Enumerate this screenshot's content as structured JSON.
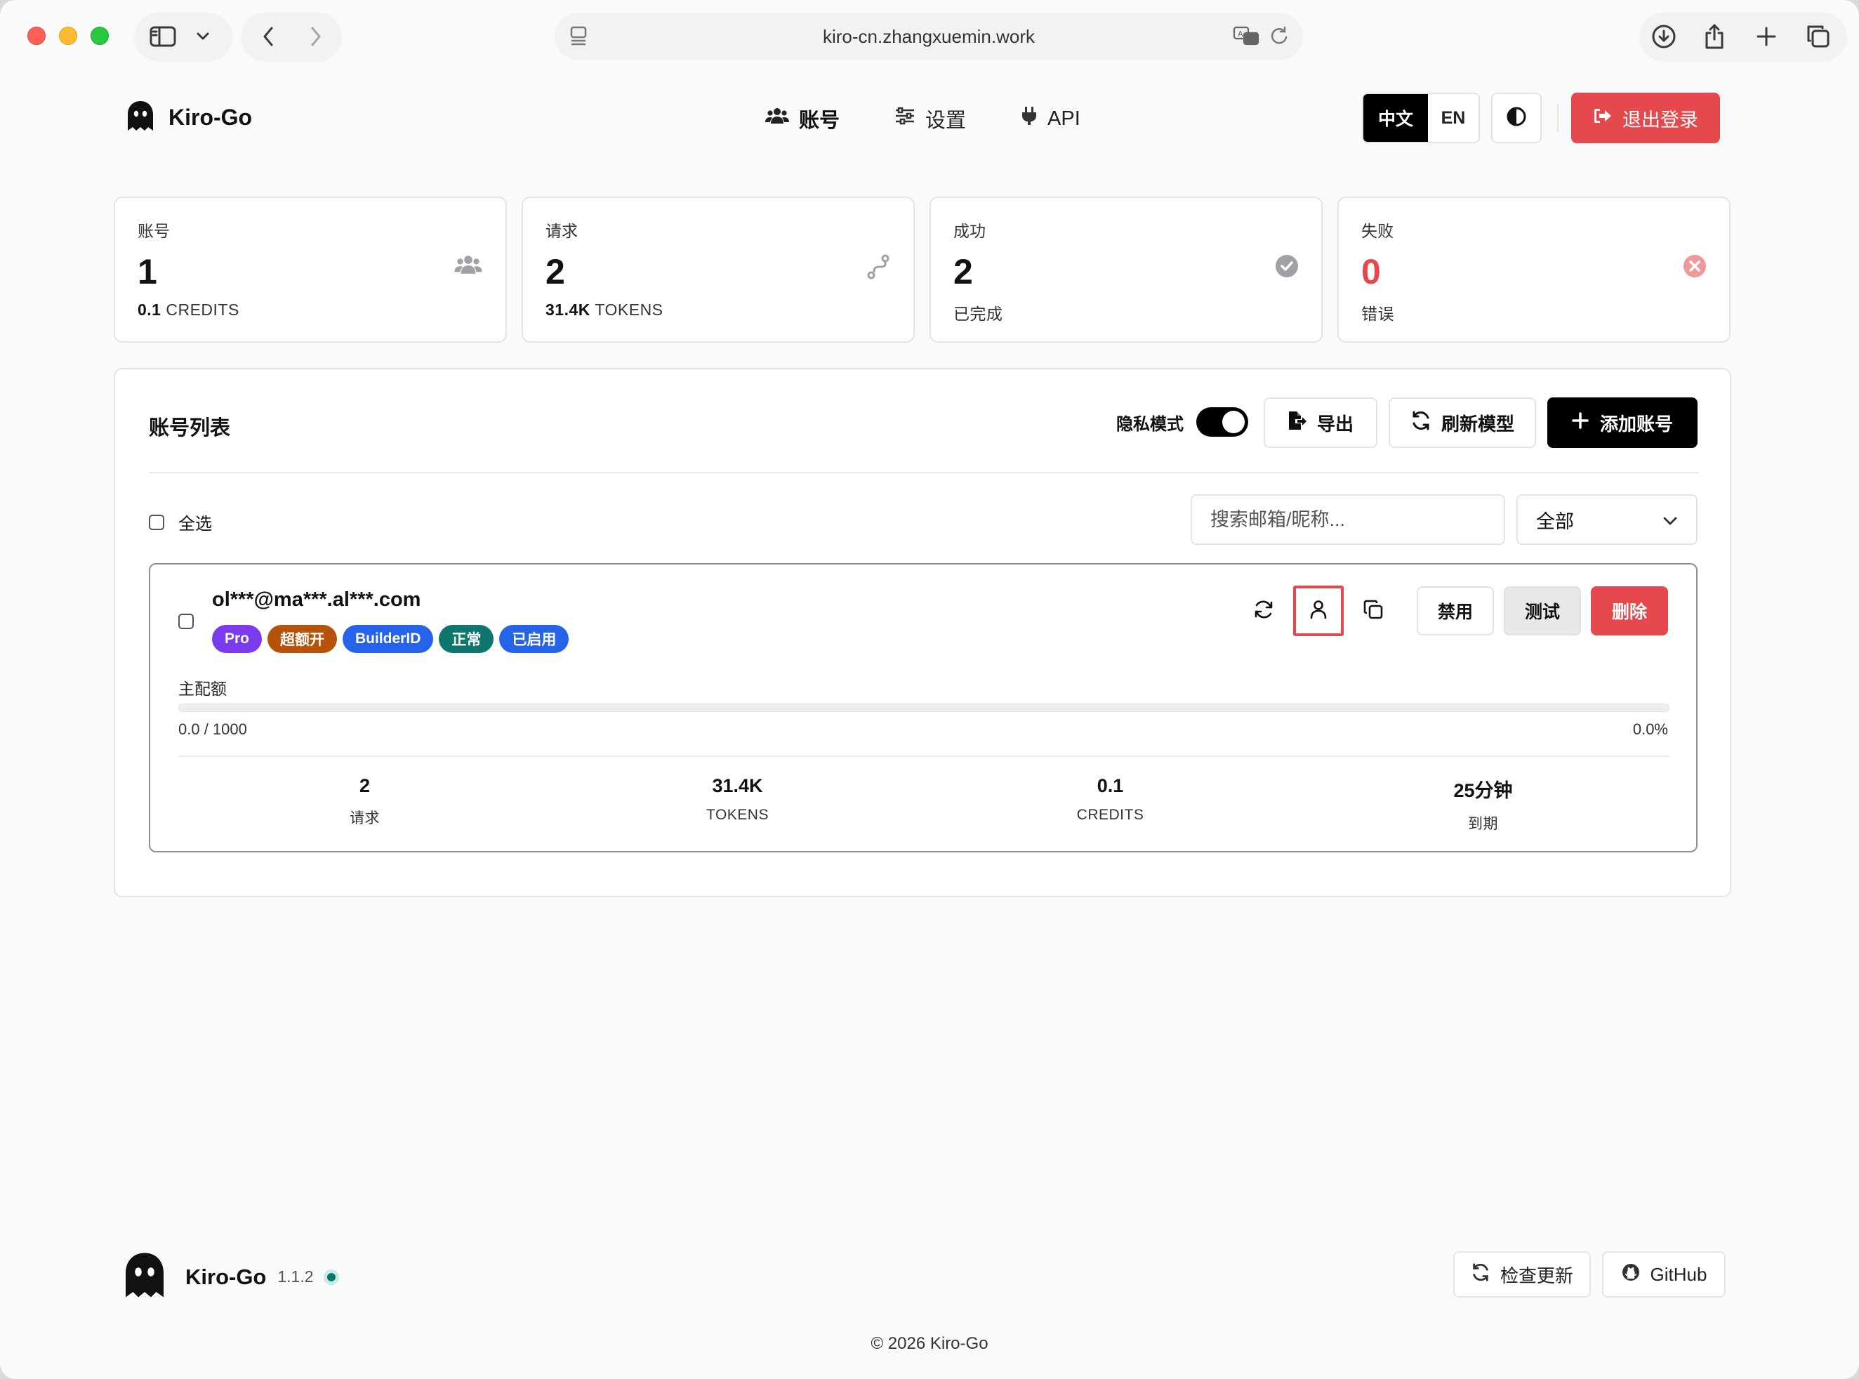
{
  "browser": {
    "url": "kiro-cn.zhangxuemin.work"
  },
  "header": {
    "brand": "Kiro-Go",
    "nav": [
      {
        "label": "账号",
        "icon": "users-icon"
      },
      {
        "label": "设置",
        "icon": "sliders-icon"
      },
      {
        "label": "API",
        "icon": "plug-icon"
      }
    ],
    "lang_zh": "中文",
    "lang_en": "EN",
    "logout": "退出登录"
  },
  "stats": [
    {
      "label": "账号",
      "value": "1",
      "sub_value": "0.1",
      "sub_label": "CREDITS",
      "icon": "users-icon"
    },
    {
      "label": "请求",
      "value": "2",
      "sub_value": "31.4K",
      "sub_label": "TOKENS",
      "icon": "route-icon"
    },
    {
      "label": "成功",
      "value": "2",
      "sub_value": "",
      "sub_label": "已完成",
      "icon": "check-circle-icon"
    },
    {
      "label": "失败",
      "value": "0",
      "sub_value": "",
      "sub_label": "错误",
      "icon": "x-circle-icon"
    }
  ],
  "panel": {
    "title": "账号列表",
    "privacy_label": "隐私模式",
    "export": "导出",
    "refresh_models": "刷新模型",
    "add_account": "添加账号",
    "select_all": "全选",
    "search_placeholder": "搜索邮箱/昵称...",
    "filter_value": "全部"
  },
  "account": {
    "email": "ol***@ma***.al***.com",
    "badges": [
      {
        "label": "Pro",
        "color": "#7c3aed"
      },
      {
        "label": "超额开",
        "color": "#b45309"
      },
      {
        "label": "BuilderID",
        "color": "#2563eb"
      },
      {
        "label": "正常",
        "color": "#0f766e"
      },
      {
        "label": "已启用",
        "color": "#2563eb"
      }
    ],
    "disable": "禁用",
    "test": "测试",
    "delete": "删除",
    "quota_label": "主配额",
    "quota_used": "0.0 / 1000",
    "quota_pct": "0.0%",
    "quota_fraction": 0.0,
    "stats": [
      {
        "value": "2",
        "label": "请求"
      },
      {
        "value": "31.4K",
        "label": "TOKENS"
      },
      {
        "value": "0.1",
        "label": "CREDITS"
      },
      {
        "value": "25分钟",
        "label": "到期"
      }
    ]
  },
  "footer": {
    "name": "Kiro-Go",
    "version": "1.1.2",
    "check_update": "检查更新",
    "github": "GitHub",
    "copyright": "© 2026 Kiro-Go"
  },
  "colors": {
    "accent_red": "#e5484d",
    "black": "#000000"
  }
}
